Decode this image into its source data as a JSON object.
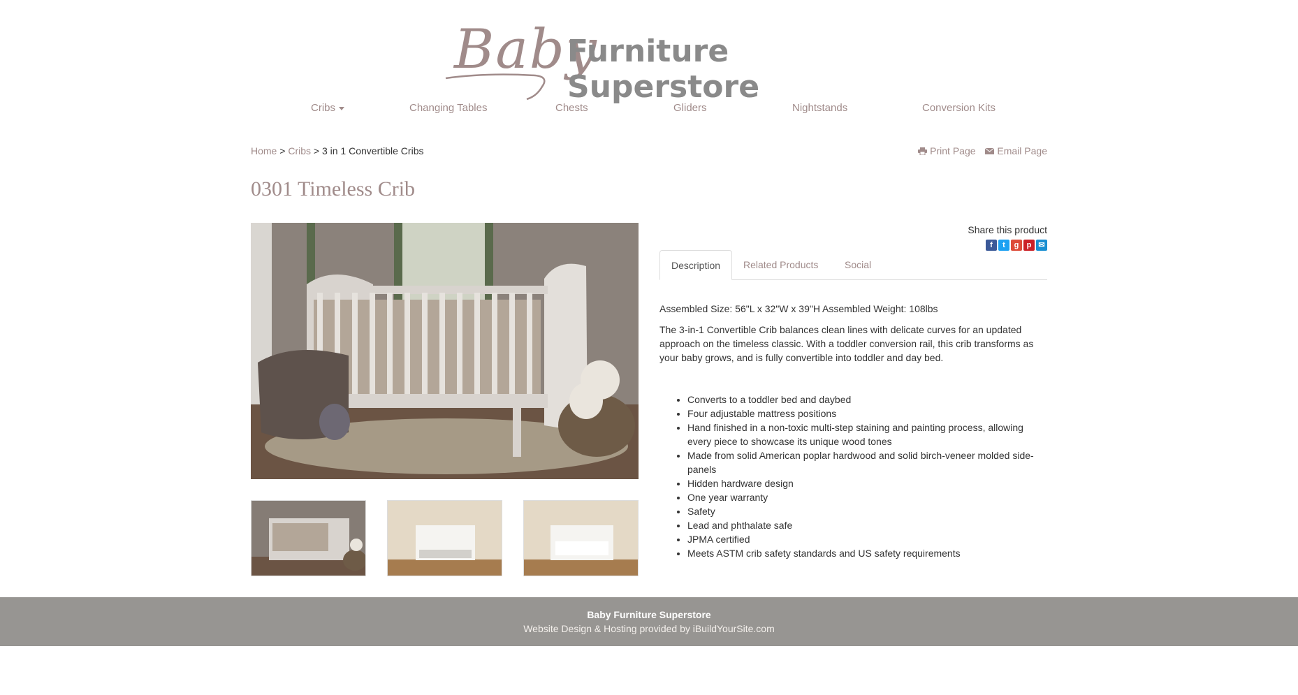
{
  "brand": {
    "script": "Baby",
    "rest": "Furniture Superstore"
  },
  "nav": {
    "items": [
      {
        "label": "Cribs",
        "dropdown": true
      },
      {
        "label": "Changing Tables"
      },
      {
        "label": "Chests"
      },
      {
        "label": "Gliders"
      },
      {
        "label": "Nightstands"
      },
      {
        "label": "Conversion Kits"
      }
    ]
  },
  "breadcrumb": {
    "home": "Home",
    "sep1": " > ",
    "cribs": "Cribs",
    "sep2": " > ",
    "current": "3 in 1 Convertible Cribs"
  },
  "tools": {
    "print": "Print Page",
    "email": "Email Page"
  },
  "product": {
    "title": "0301 Timeless Crib"
  },
  "share": {
    "label": "Share this product",
    "icons": [
      "facebook-icon",
      "twitter-icon",
      "google-plus-icon",
      "pinterest-icon",
      "email-icon"
    ]
  },
  "tabs": [
    "Description",
    "Related Products",
    "Social"
  ],
  "description": {
    "size": "Assembled Size: 56\"L x 32\"W x 39\"H Assembled Weight: 108lbs",
    "body": "The 3-in-1 Convertible Crib balances clean lines with delicate curves for an updated approach on the timeless classic. With a toddler conversion rail, this crib transforms as your baby grows, and is fully convertible into toddler and day bed.",
    "features": [
      "Converts to a toddler bed and daybed",
      "Four adjustable mattress positions",
      "Hand finished in a non-toxic multi-step staining and painting process, allowing every piece to showcase its unique wood tones",
      "Made from solid American poplar hardwood and solid birch-veneer molded side-panels",
      "Hidden hardware design",
      "One year warranty",
      "Safety",
      "Lead and phthalate safe",
      "JPMA certified",
      "Meets ASTM crib safety standards and US safety requirements"
    ]
  },
  "footer": {
    "name": "Baby Furniture Superstore",
    "credit_prefix": "Website Design & Hosting provided by ",
    "credit_link": "iBuildYourSite.com"
  },
  "colors": {
    "accent": "#a08b8a",
    "footer_bg": "#979592"
  }
}
